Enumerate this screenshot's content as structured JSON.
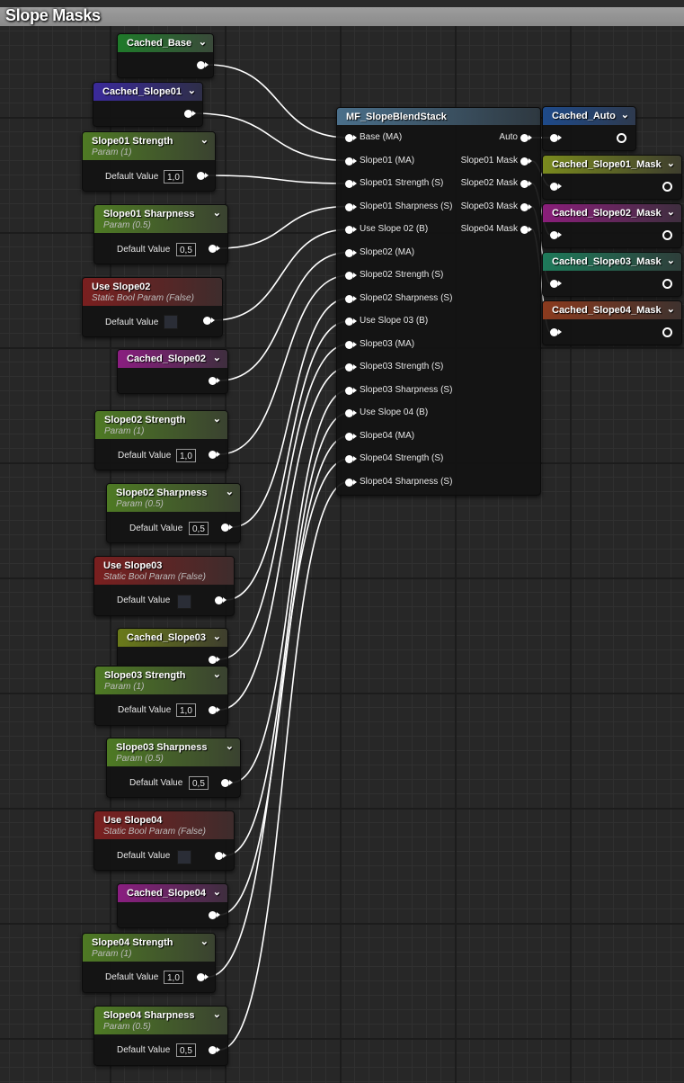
{
  "comment": {
    "title": "Slope Masks"
  },
  "nodes": {
    "cached_base": {
      "title": "Cached_Base"
    },
    "cached_slope01": {
      "title": "Cached_Slope01"
    },
    "slope01_strength": {
      "title": "Slope01 Strength",
      "subtitle": "Param (1)",
      "label": "Default Value",
      "value": "1,0"
    },
    "slope01_sharpness": {
      "title": "Slope01 Sharpness",
      "subtitle": "Param (0.5)",
      "label": "Default Value",
      "value": "0,5"
    },
    "use_slope02": {
      "title": "Use Slope02",
      "subtitle": "Static Bool Param (False)",
      "label": "Default Value"
    },
    "cached_slope02": {
      "title": "Cached_Slope02"
    },
    "slope02_strength": {
      "title": "Slope02 Strength",
      "subtitle": "Param (1)",
      "label": "Default Value",
      "value": "1,0"
    },
    "slope02_sharpness": {
      "title": "Slope02 Sharpness",
      "subtitle": "Param (0.5)",
      "label": "Default Value",
      "value": "0,5"
    },
    "use_slope03": {
      "title": "Use Slope03",
      "subtitle": "Static Bool Param (False)",
      "label": "Default Value"
    },
    "cached_slope03": {
      "title": "Cached_Slope03"
    },
    "slope03_strength": {
      "title": "Slope03 Strength",
      "subtitle": "Param (1)",
      "label": "Default Value",
      "value": "1,0"
    },
    "slope03_sharpness": {
      "title": "Slope03 Sharpness",
      "subtitle": "Param (0.5)",
      "label": "Default Value",
      "value": "0,5"
    },
    "use_slope04": {
      "title": "Use Slope04",
      "subtitle": "Static Bool Param (False)",
      "label": "Default Value"
    },
    "cached_slope04": {
      "title": "Cached_Slope04"
    },
    "slope04_strength": {
      "title": "Slope04 Strength",
      "subtitle": "Param (1)",
      "label": "Default Value",
      "value": "1,0"
    },
    "slope04_sharpness": {
      "title": "Slope04 Sharpness",
      "subtitle": "Param (0.5)",
      "label": "Default Value",
      "value": "0,5"
    }
  },
  "blend": {
    "title": "MF_SlopeBlendStack",
    "inputs": [
      "Base (MA)",
      "Slope01 (MA)",
      "Slope01 Strength (S)",
      "Slope01 Sharpness (S)",
      "Use Slope 02 (B)",
      "Slope02 (MA)",
      "Slope02 Strength (S)",
      "Slope02 Sharpness (S)",
      "Use Slope 03 (B)",
      "Slope03 (MA)",
      "Slope03 Strength (S)",
      "Slope03 Sharpness (S)",
      "Use Slope 04 (B)",
      "Slope04 (MA)",
      "Slope04 Strength (S)",
      "Slope04 Sharpness (S)"
    ],
    "outputs": [
      "Auto",
      "Slope01 Mask",
      "Slope02 Mask",
      "Slope03 Mask",
      "Slope04 Mask"
    ]
  },
  "outputs": {
    "cached_auto": {
      "title": "Cached_Auto"
    },
    "cached_slope01_mask": {
      "title": "Cached_Slope01_Mask"
    },
    "cached_slope02_mask": {
      "title": "Cached_Slope02_Mask"
    },
    "cached_slope03_mask": {
      "title": "Cached_Slope03_Mask"
    },
    "cached_slope04_mask": {
      "title": "Cached_Slope04_Mask"
    }
  },
  "colors": {
    "header_green": "#1f7a2a",
    "header_blue_purple": "#3a2a9a",
    "header_param": "#4e7a24",
    "header_bool": "#7a1f1f",
    "header_magenta": "#8a1e80",
    "header_olive": "#6a7a1a",
    "header_mf": "#4a6f8a",
    "header_auto": "#1e4a8a",
    "header_mask01": "#7a8a1e",
    "header_mask02": "#8a1e7a",
    "header_mask03": "#1e7a5a",
    "header_mask04": "#8a3a1e"
  }
}
